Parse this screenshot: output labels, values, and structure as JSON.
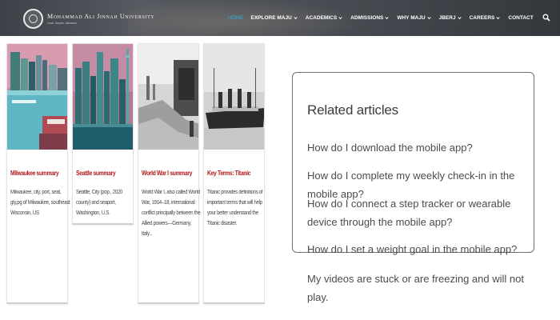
{
  "header": {
    "brand_name": "Mohammad Ali Jinnah University",
    "brand_tagline": "Lead. Inspire. Advance.",
    "nav": [
      {
        "label": "HOME",
        "has_dropdown": false,
        "active": true
      },
      {
        "label": "EXPLORE MAJU",
        "has_dropdown": true,
        "active": false
      },
      {
        "label": "ACADEMICS",
        "has_dropdown": true,
        "active": false
      },
      {
        "label": "ADMISSIONS",
        "has_dropdown": true,
        "active": false
      },
      {
        "label": "WHY MAJU",
        "has_dropdown": true,
        "active": false
      },
      {
        "label": "JBERJ",
        "has_dropdown": true,
        "active": false
      },
      {
        "label": "CAREERS",
        "has_dropdown": true,
        "active": false
      },
      {
        "label": "CONTACT",
        "has_dropdown": false,
        "active": false
      }
    ],
    "search_icon": "search-icon",
    "active_color": "#33a7de"
  },
  "cards": [
    {
      "title": "Milwaukee summary",
      "description": "Milwaukee, city, port, seat, gty,pg of Milwaukee, southeast Wisconsin, US",
      "image": "harbor-city-image"
    },
    {
      "title": "Seattle summary",
      "description": "Seattle, City (pop., 2020 county) and seaport, Washington, U.S.",
      "image": "skyline-image"
    },
    {
      "title": "World War I summary",
      "description": "World War I, also called World War, 1914–18, international conflict principally between the Allied powers—Germany, Italy...",
      "image": "battlefield-image"
    },
    {
      "title": "Key Terms: Titanic",
      "description": "Titanic provides definitions of important terms that will help your better understand the Titanic disaster.",
      "image": "ocean-liner-image"
    }
  ],
  "related": {
    "title": "Related articles",
    "links": [
      "How do I download the mobile app?",
      "How do I complete my weekly check-in in the mobile app?",
      "How do I connect a step tracker or wearable device through the mobile app?",
      "How do I set a weight goal in the mobile app?",
      "My videos are stuck or are freezing and will not play."
    ]
  },
  "colors": {
    "card_title": "#b3191b",
    "link_text": "#4c4c4c",
    "nav_bar": "#4a4e54"
  }
}
